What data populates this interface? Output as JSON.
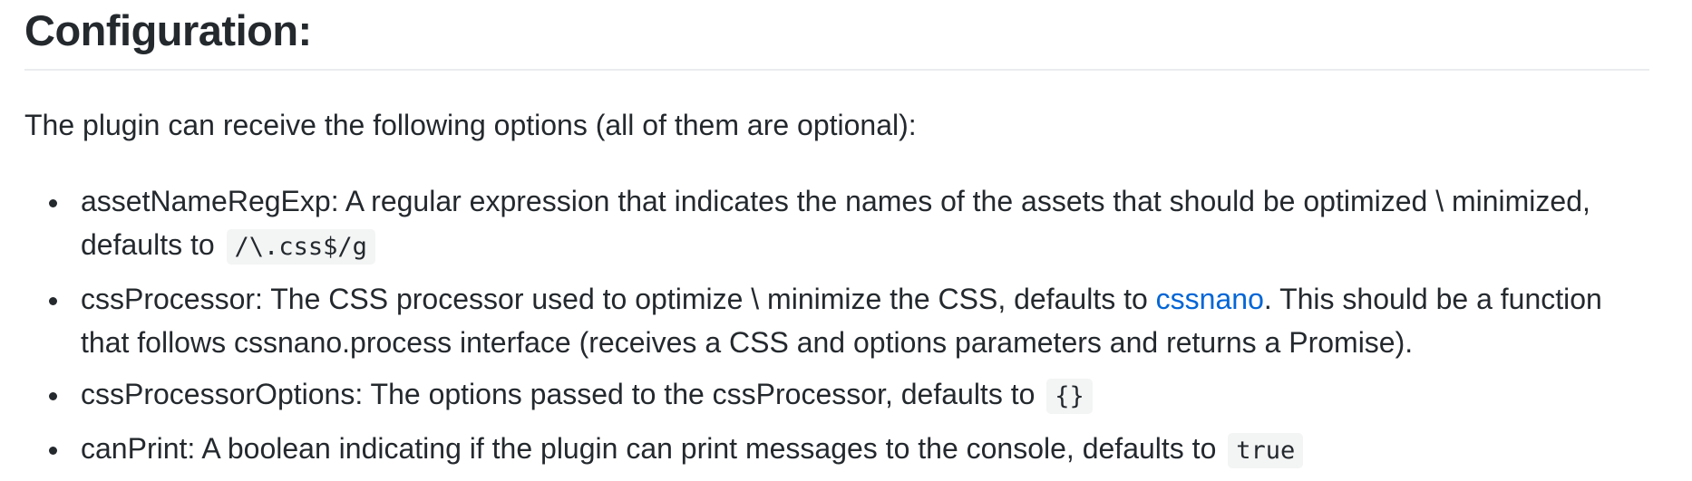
{
  "heading": "Configuration:",
  "intro": "The plugin can receive the following options (all of them are optional):",
  "options": [
    {
      "text": "assetNameRegExp: A regular expression that indicates the names of the assets that should be optimized \\ minimized, defaults to",
      "code": "/\\.css$/g"
    },
    {
      "text_before": "cssProcessor: The CSS processor used to optimize \\ minimize the CSS, defaults to ",
      "link": "cssnano",
      "text_after": ". This should be a function that follows cssnano.process interface (receives a CSS and options parameters and returns a Promise)."
    },
    {
      "text": "cssProcessorOptions: The options passed to the cssProcessor, defaults to",
      "code": "{}"
    },
    {
      "text": "canPrint: A boolean indicating if the plugin can print messages to the console, defaults to",
      "code": "true"
    }
  ],
  "colors": {
    "text": "#24292e",
    "link": "#0366d6",
    "code_bg": "#f3f4f4",
    "rule": "#eaecef"
  }
}
